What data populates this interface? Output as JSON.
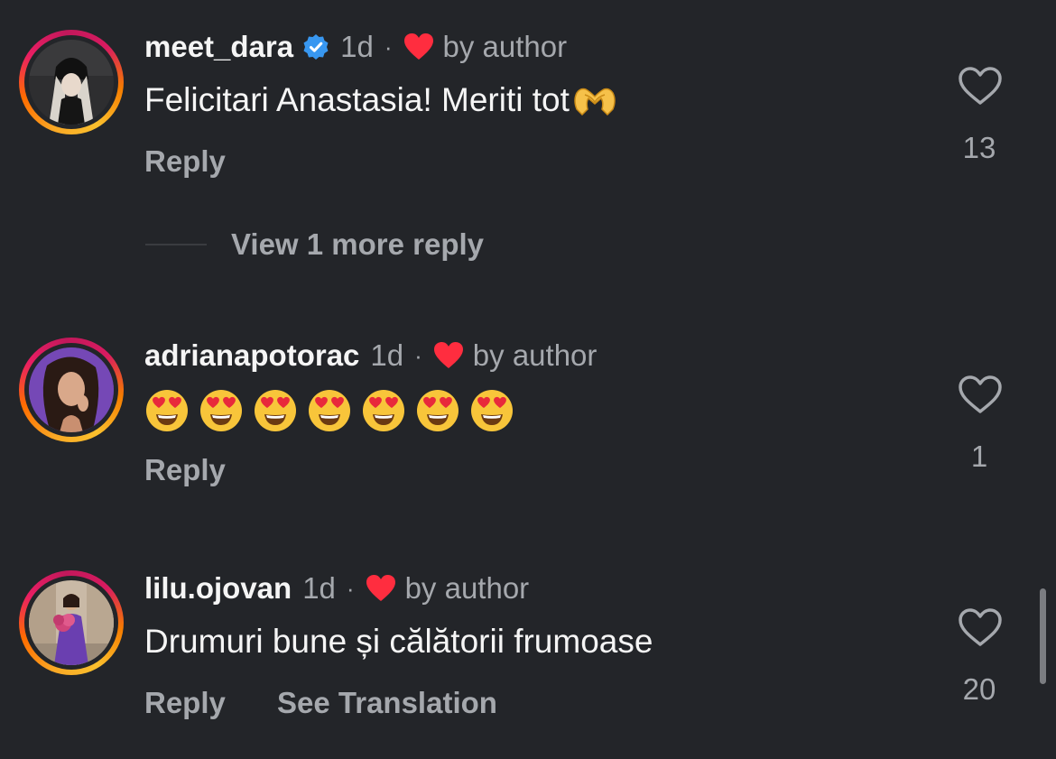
{
  "comments": [
    {
      "username": "meet_dara",
      "verified": true,
      "time": "1d",
      "separator": "·",
      "liked_by": "by author",
      "text": "Felicitari Anastasia! Meriti tot",
      "text_emoji": "heart-hands-emoji",
      "reply_label": "Reply",
      "like_count": "13",
      "view_more": "View 1 more reply"
    },
    {
      "username": "adrianapotorac",
      "verified": false,
      "time": "1d",
      "separator": "·",
      "liked_by": "by author",
      "emoji_row": [
        "heart-eyes-emoji",
        "heart-eyes-emoji",
        "heart-eyes-emoji",
        "heart-eyes-emoji",
        "heart-eyes-emoji",
        "heart-eyes-emoji",
        "heart-eyes-emoji"
      ],
      "reply_label": "Reply",
      "like_count": "1"
    },
    {
      "username": "lilu.ojovan",
      "verified": false,
      "time": "1d",
      "separator": "·",
      "liked_by": "by author",
      "text": "Drumuri bune și călătorii frumoase",
      "reply_label": "Reply",
      "translate_label": "See Translation",
      "like_count": "20"
    }
  ],
  "colors": {
    "background": "#232529",
    "primary_text": "#f5f5f5",
    "secondary_text": "#a5a8ad",
    "heart_red": "#ff2d3f",
    "verified_blue": "#3897f0"
  }
}
